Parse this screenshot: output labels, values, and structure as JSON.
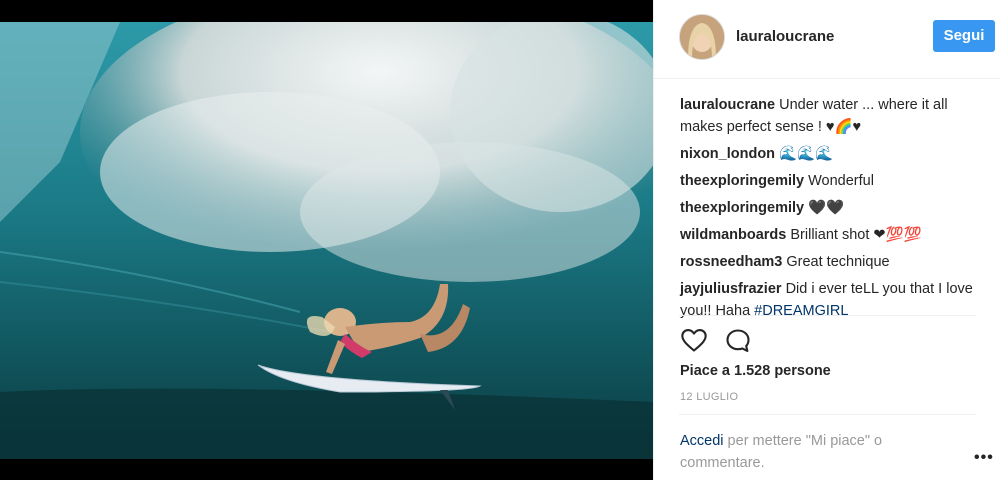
{
  "post": {
    "username": "lauraloucrane",
    "follow_label": "Segui",
    "likes_text": "Piace a 1.528 persone",
    "date_text": "12 LUGLIO"
  },
  "comments": [
    {
      "user": "lauraloucrane",
      "text": "Under water ... where it all makes perfect sense ! ♥🌈♥"
    },
    {
      "user": "nixon_london",
      "text": "🌊🌊🌊"
    },
    {
      "user": "theexploringemily",
      "text": "Wonderful"
    },
    {
      "user": "theexploringemily",
      "text": "🖤🖤"
    },
    {
      "user": "wildmanboards",
      "text": "Brilliant shot ❤💯💯"
    },
    {
      "user": "rossneedham3",
      "text": "Great technique"
    },
    {
      "user": "jayjuliusfrazier",
      "text": "Did i ever teLL you that I love you!! Haha ",
      "hashtag": "#DREAMGIRL"
    }
  ],
  "login": {
    "link_text": "Accedi",
    "rest_text": " per mettere \"Mi piace\" o commentare."
  },
  "icons": {
    "like": "heart-icon",
    "comment": "comment-bubble-icon",
    "more": "more-options-icon"
  },
  "colors": {
    "follow_button": "#3897f0",
    "link": "#003569",
    "muted": "#999999"
  }
}
